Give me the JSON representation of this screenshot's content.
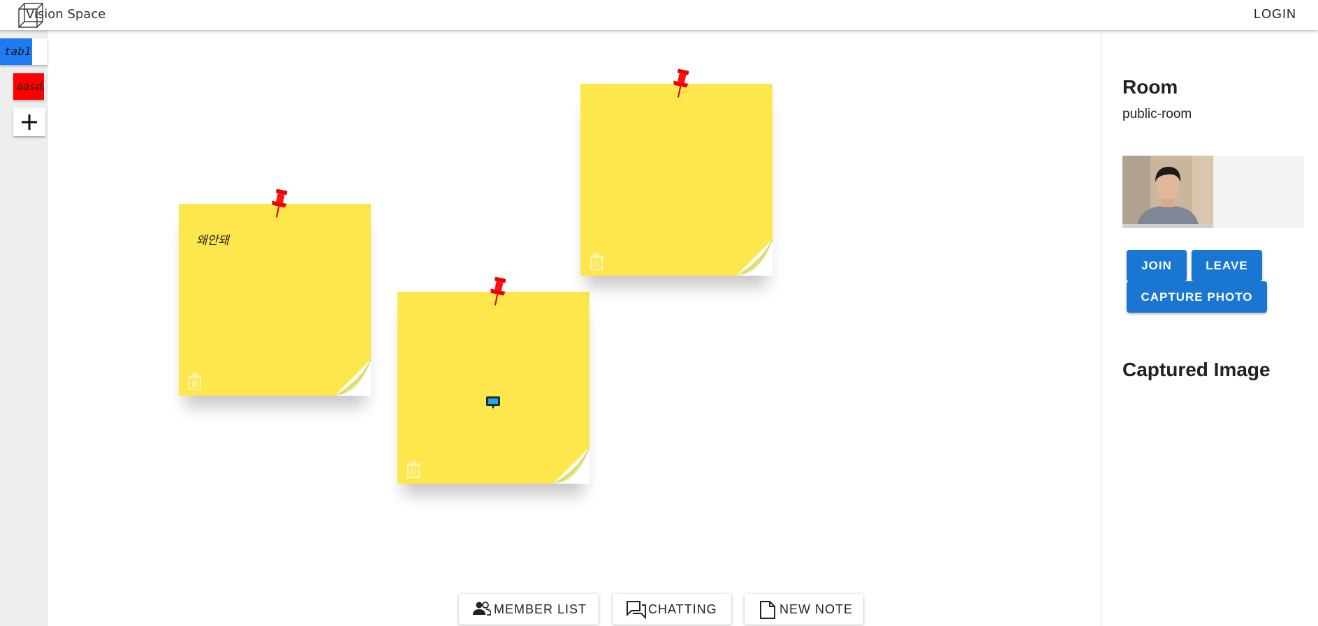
{
  "header": {
    "brand": "Vision Space",
    "login_label": "LOGIN"
  },
  "tabs": [
    {
      "label": "tab1",
      "color": "#1e7cf2"
    },
    {
      "label": "aasda",
      "color": "#ff0000"
    }
  ],
  "add_tab_icon": "plus-icon",
  "notes": [
    {
      "text": "왜안돼"
    },
    {
      "text": ""
    },
    {
      "text": ""
    }
  ],
  "note_color": "#fde74c",
  "right_panel": {
    "room_title": "Room",
    "room_name": "public-room",
    "join_label": "JOIN",
    "leave_label": "LEAVE",
    "capture_label": "CAPTURE PHOTO",
    "captured_title": "Captured Image"
  },
  "bottom_bar": {
    "member_list_label": "MEMBER LIST",
    "chatting_label": "CHATTING",
    "new_note_label": "NEW NOTE"
  },
  "accent_color": "#1976d2"
}
